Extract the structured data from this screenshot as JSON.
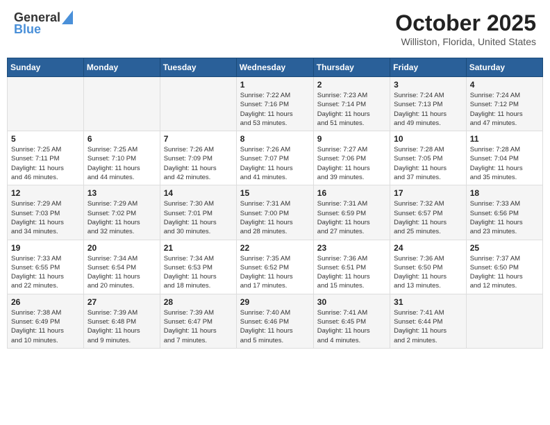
{
  "header": {
    "logo_general": "General",
    "logo_blue": "Blue",
    "month_title": "October 2025",
    "location": "Williston, Florida, United States"
  },
  "weekdays": [
    "Sunday",
    "Monday",
    "Tuesday",
    "Wednesday",
    "Thursday",
    "Friday",
    "Saturday"
  ],
  "weeks": [
    [
      {
        "day": "",
        "info": ""
      },
      {
        "day": "",
        "info": ""
      },
      {
        "day": "",
        "info": ""
      },
      {
        "day": "1",
        "info": "Sunrise: 7:22 AM\nSunset: 7:16 PM\nDaylight: 11 hours\nand 53 minutes."
      },
      {
        "day": "2",
        "info": "Sunrise: 7:23 AM\nSunset: 7:14 PM\nDaylight: 11 hours\nand 51 minutes."
      },
      {
        "day": "3",
        "info": "Sunrise: 7:24 AM\nSunset: 7:13 PM\nDaylight: 11 hours\nand 49 minutes."
      },
      {
        "day": "4",
        "info": "Sunrise: 7:24 AM\nSunset: 7:12 PM\nDaylight: 11 hours\nand 47 minutes."
      }
    ],
    [
      {
        "day": "5",
        "info": "Sunrise: 7:25 AM\nSunset: 7:11 PM\nDaylight: 11 hours\nand 46 minutes."
      },
      {
        "day": "6",
        "info": "Sunrise: 7:25 AM\nSunset: 7:10 PM\nDaylight: 11 hours\nand 44 minutes."
      },
      {
        "day": "7",
        "info": "Sunrise: 7:26 AM\nSunset: 7:09 PM\nDaylight: 11 hours\nand 42 minutes."
      },
      {
        "day": "8",
        "info": "Sunrise: 7:26 AM\nSunset: 7:07 PM\nDaylight: 11 hours\nand 41 minutes."
      },
      {
        "day": "9",
        "info": "Sunrise: 7:27 AM\nSunset: 7:06 PM\nDaylight: 11 hours\nand 39 minutes."
      },
      {
        "day": "10",
        "info": "Sunrise: 7:28 AM\nSunset: 7:05 PM\nDaylight: 11 hours\nand 37 minutes."
      },
      {
        "day": "11",
        "info": "Sunrise: 7:28 AM\nSunset: 7:04 PM\nDaylight: 11 hours\nand 35 minutes."
      }
    ],
    [
      {
        "day": "12",
        "info": "Sunrise: 7:29 AM\nSunset: 7:03 PM\nDaylight: 11 hours\nand 34 minutes."
      },
      {
        "day": "13",
        "info": "Sunrise: 7:29 AM\nSunset: 7:02 PM\nDaylight: 11 hours\nand 32 minutes."
      },
      {
        "day": "14",
        "info": "Sunrise: 7:30 AM\nSunset: 7:01 PM\nDaylight: 11 hours\nand 30 minutes."
      },
      {
        "day": "15",
        "info": "Sunrise: 7:31 AM\nSunset: 7:00 PM\nDaylight: 11 hours\nand 28 minutes."
      },
      {
        "day": "16",
        "info": "Sunrise: 7:31 AM\nSunset: 6:59 PM\nDaylight: 11 hours\nand 27 minutes."
      },
      {
        "day": "17",
        "info": "Sunrise: 7:32 AM\nSunset: 6:57 PM\nDaylight: 11 hours\nand 25 minutes."
      },
      {
        "day": "18",
        "info": "Sunrise: 7:33 AM\nSunset: 6:56 PM\nDaylight: 11 hours\nand 23 minutes."
      }
    ],
    [
      {
        "day": "19",
        "info": "Sunrise: 7:33 AM\nSunset: 6:55 PM\nDaylight: 11 hours\nand 22 minutes."
      },
      {
        "day": "20",
        "info": "Sunrise: 7:34 AM\nSunset: 6:54 PM\nDaylight: 11 hours\nand 20 minutes."
      },
      {
        "day": "21",
        "info": "Sunrise: 7:34 AM\nSunset: 6:53 PM\nDaylight: 11 hours\nand 18 minutes."
      },
      {
        "day": "22",
        "info": "Sunrise: 7:35 AM\nSunset: 6:52 PM\nDaylight: 11 hours\nand 17 minutes."
      },
      {
        "day": "23",
        "info": "Sunrise: 7:36 AM\nSunset: 6:51 PM\nDaylight: 11 hours\nand 15 minutes."
      },
      {
        "day": "24",
        "info": "Sunrise: 7:36 AM\nSunset: 6:50 PM\nDaylight: 11 hours\nand 13 minutes."
      },
      {
        "day": "25",
        "info": "Sunrise: 7:37 AM\nSunset: 6:50 PM\nDaylight: 11 hours\nand 12 minutes."
      }
    ],
    [
      {
        "day": "26",
        "info": "Sunrise: 7:38 AM\nSunset: 6:49 PM\nDaylight: 11 hours\nand 10 minutes."
      },
      {
        "day": "27",
        "info": "Sunrise: 7:39 AM\nSunset: 6:48 PM\nDaylight: 11 hours\nand 9 minutes."
      },
      {
        "day": "28",
        "info": "Sunrise: 7:39 AM\nSunset: 6:47 PM\nDaylight: 11 hours\nand 7 minutes."
      },
      {
        "day": "29",
        "info": "Sunrise: 7:40 AM\nSunset: 6:46 PM\nDaylight: 11 hours\nand 5 minutes."
      },
      {
        "day": "30",
        "info": "Sunrise: 7:41 AM\nSunset: 6:45 PM\nDaylight: 11 hours\nand 4 minutes."
      },
      {
        "day": "31",
        "info": "Sunrise: 7:41 AM\nSunset: 6:44 PM\nDaylight: 11 hours\nand 2 minutes."
      },
      {
        "day": "",
        "info": ""
      }
    ]
  ]
}
